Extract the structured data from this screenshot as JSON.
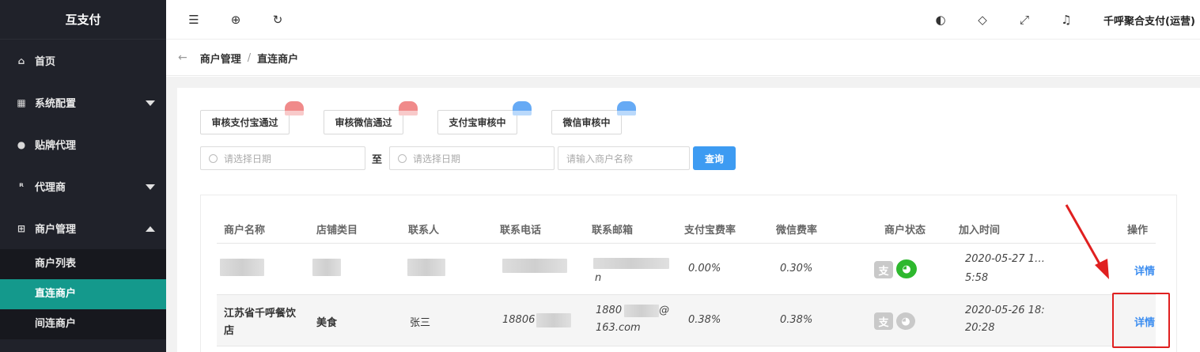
{
  "sidebar": {
    "brand": "互支付",
    "items": [
      {
        "label": "首页",
        "icon": "home-icon"
      },
      {
        "label": "系统配置",
        "icon": "config-icon"
      },
      {
        "label": "贴牌代理",
        "icon": "user-icon"
      },
      {
        "label": "代理商",
        "icon": "person-icon"
      },
      {
        "label": "商户管理",
        "icon": "merchant-icon"
      }
    ],
    "sub_items": [
      "商户列表",
      "直连商户",
      "间连商户"
    ]
  },
  "topbar": {
    "user": "千呼聚合支付(运营)",
    "icons": [
      "menu-fold-icon",
      "globe-icon",
      "refresh-icon",
      "palette-icon",
      "tag-icon",
      "fullscreen-icon",
      "bell-icon"
    ]
  },
  "breadcrumb": {
    "level1": "商户管理",
    "separator": "/",
    "level2": "直连商户"
  },
  "filters": {
    "buttons": [
      "审核支付宝通过",
      "审核微信通过",
      "支付宝审核中",
      "微信审核中"
    ],
    "start_date_placeholder": "请选择日期",
    "to_label": "至",
    "end_date_placeholder": "请选择日期",
    "name_placeholder": "请输入商户名称",
    "query_label": "查询"
  },
  "table": {
    "headers": [
      "商户名称",
      "店铺类目",
      "联系人",
      "联系电话",
      "联系邮箱",
      "支付宝费率",
      "微信费率",
      "商户状态",
      "加入时间",
      "操作"
    ],
    "rows": [
      {
        "name": "",
        "category": "",
        "contact": "",
        "phone": "",
        "email_tail": "n",
        "ali_rate": "0.00%",
        "wx_rate": "0.30%",
        "time_line1": "2020-05-27 1…",
        "time_line2": "5:58",
        "action": "详情"
      },
      {
        "name_line1": "江苏省千呼餐饮",
        "name_line2": "店",
        "category": "美食",
        "contact": "张三",
        "phone": "18806",
        "email_line1_a": "1880",
        "email_line1_b": "@",
        "email_line2": "163.com",
        "ali_rate": "0.38%",
        "wx_rate": "0.38%",
        "time_line1": "2020-05-26 18:",
        "time_line2": "20:28",
        "action": "详情"
      }
    ]
  },
  "colors": {
    "sidebar_bg": "#20222a",
    "active": "#14998c",
    "primary": "#3d9bf2",
    "highlight": "#e02020"
  }
}
